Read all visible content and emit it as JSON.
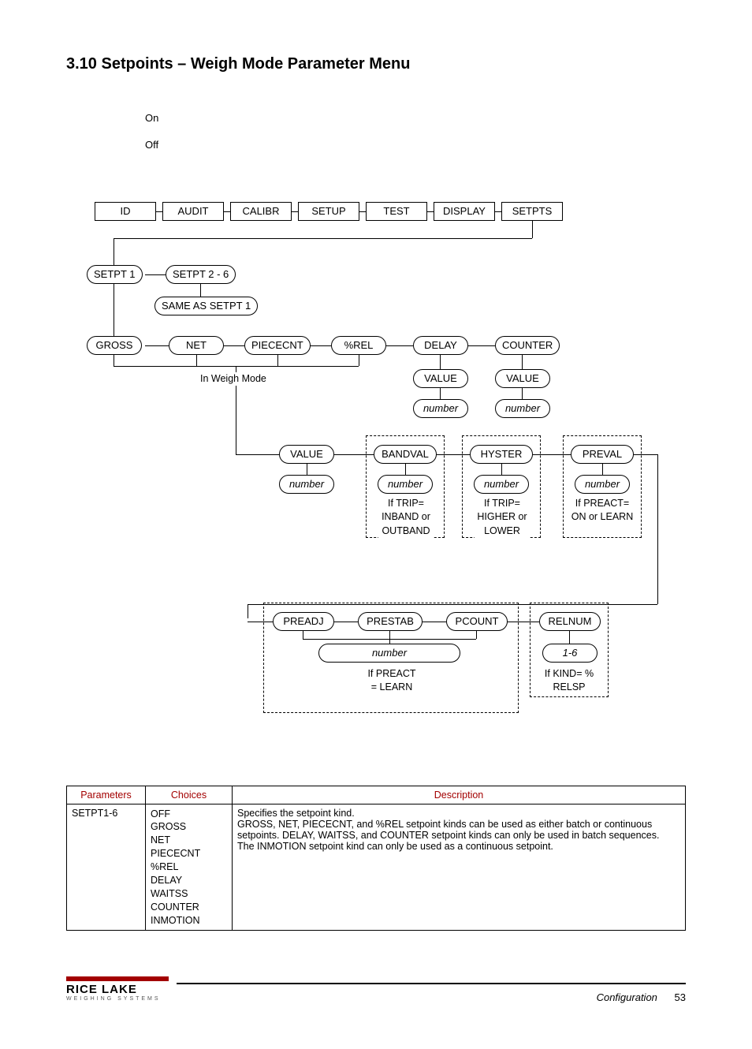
{
  "heading": "3.10   Setpoints – Weigh Mode Parameter Menu",
  "toggle": {
    "on": "On",
    "off": "Off"
  },
  "menu_row": [
    "ID",
    "AUDIT",
    "CALIBR",
    "SETUP",
    "TEST",
    "DISPLAY",
    "SETPTS"
  ],
  "setpt": {
    "one": "SETPT 1",
    "rest": "SETPT 2 - 6",
    "same": "SAME AS SETPT 1"
  },
  "kind_row": [
    "GROSS",
    "NET",
    "PIECECNT",
    "%REL",
    "DELAY",
    "COUNTER"
  ],
  "weighmode_label": "In Weigh Mode",
  "sub": {
    "value": "VALUE",
    "number": "number",
    "bandval": "BANDVAL",
    "hyster": "HYSTER",
    "preval": "PREVAL",
    "preadj": "PREADJ",
    "prestab": "PRESTAB",
    "pcount": "PCOUNT",
    "relnum": "RELNUM",
    "one_six": "1-6"
  },
  "notes": {
    "bandval": "If TRIP= INBAND or OUTBAND",
    "hyster": "If TRIP= HIGHER or LOWER",
    "preval": "If PREACT= ON or LEARN",
    "preact_learn": "If PREACT = LEARN",
    "relnum": "If KIND= % RELSP"
  },
  "table": {
    "headers": [
      "Parameters",
      "Choices",
      "Description"
    ],
    "row": {
      "param": "SETPT1-6",
      "choices": [
        "OFF",
        "GROSS",
        "NET",
        "PIECECNT",
        "%REL",
        "DELAY",
        "WAITSS",
        "COUNTER",
        "INMOTION"
      ],
      "description": "Specifies the setpoint kind.\nGROSS, NET, PIECECNT, and %REL setpoint kinds can be used as either batch or continuous setpoints. DELAY, WAITSS, and COUNTER setpoint kinds can only be used in batch sequences.\nThe INMOTION setpoint kind can only be used as a continuous setpoint."
    }
  },
  "footer": {
    "brand": "RICE LAKE",
    "tag": "WEIGHING SYSTEMS",
    "section": "Configuration",
    "page": "53"
  }
}
